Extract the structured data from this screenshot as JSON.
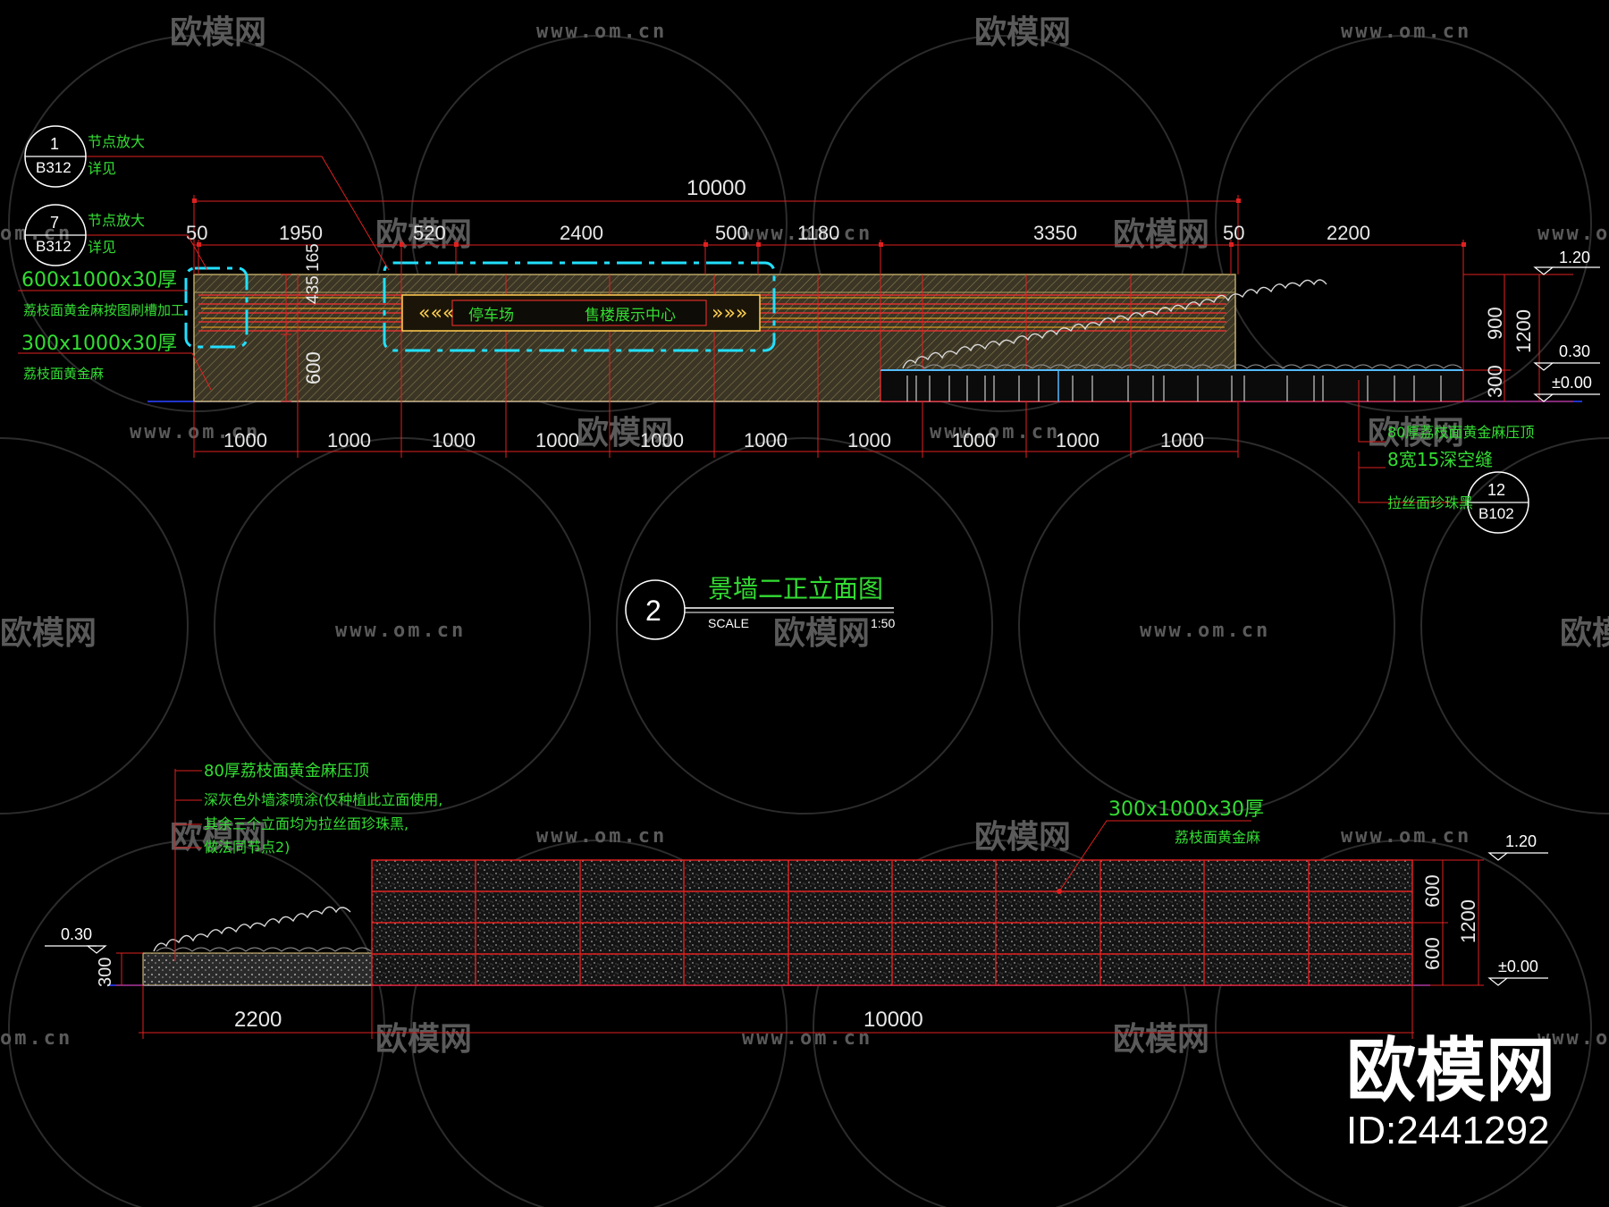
{
  "watermark": {
    "logo_text": "欧模网",
    "url_text": "www.om.cn",
    "url_partial": "om.cn"
  },
  "brand": {
    "name": "欧模网",
    "id_label": "ID:2441292"
  },
  "top_elevation": {
    "overall_dim": "10000",
    "segment_dims": [
      "50",
      "1950",
      "520",
      "2400",
      "500",
      "1180",
      "3350",
      "50",
      "2200"
    ],
    "vertical_dims": [
      "435",
      "165",
      "600"
    ],
    "right_dims": [
      "900",
      "1200",
      "300"
    ],
    "levels": [
      "1.20",
      "0.30",
      "±0.00"
    ],
    "grid_dims": [
      "1000",
      "1000",
      "1000",
      "1000",
      "1000",
      "1000",
      "1000",
      "1000",
      "1000",
      "1000"
    ],
    "bubbles": [
      {
        "num": "1",
        "sheet": "B312"
      },
      {
        "num": "7",
        "sheet": "B312"
      },
      {
        "num": "12",
        "sheet": "B102"
      }
    ],
    "notes_left": {
      "n1a": "节点放大",
      "n1b": "详见",
      "n2a": "节点放大",
      "n2b": "详见",
      "n3": "600x1000x30厚",
      "n4": "荔枝面黄金麻按图刷槽加工",
      "n5": "300x1000x30厚",
      "n6": "荔枝面黄金麻"
    },
    "notes_right": {
      "r1": "80厚荔枝面黄金麻压顶",
      "r2": "8宽15深空缝",
      "r3": "拉丝面珍珠黑"
    },
    "sign_text_1": "停车场",
    "sign_text_2": "售楼展示中心"
  },
  "title_block": {
    "number": "2",
    "title": "景墙二正立面图",
    "scale_label": "SCALE",
    "scale_value": "1:50"
  },
  "bottom_elevation": {
    "notes": {
      "b1": "80厚荔枝面黄金麻压顶",
      "b2": "深灰色外墙漆喷涂(仅种植此立面使用,",
      "b3": "其余三个立面均为拉丝面珍珠黑,",
      "b4": "做法同节点2)",
      "b5": "300x1000x30厚",
      "b6": "荔枝面黄金麻"
    },
    "dims": {
      "left": "2200",
      "main": "10000",
      "h_top": "600",
      "h_bottom": "600",
      "h_total": "1200",
      "planter_h": "300"
    },
    "levels": [
      "1.20",
      "0.30",
      "±0.00"
    ]
  }
}
